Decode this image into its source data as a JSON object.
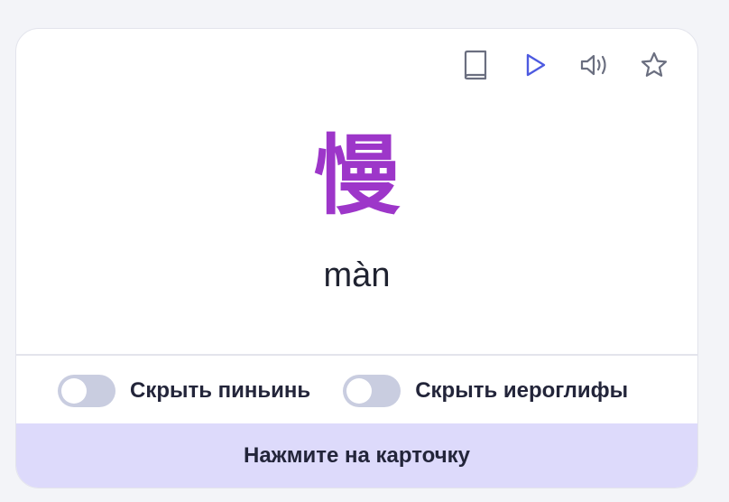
{
  "card": {
    "hanzi": "慢",
    "pinyin": "màn"
  },
  "toolbar": {
    "icons": [
      "book-icon",
      "play-icon",
      "speaker-icon",
      "star-icon"
    ]
  },
  "toggles": {
    "hide_pinyin_label": "Скрыть пиньинь",
    "hide_pinyin_on": false,
    "hide_hanzi_label": "Скрыть иероглифы",
    "hide_hanzi_on": false
  },
  "footer": {
    "label": "Нажмите на карточку"
  },
  "colors": {
    "hanzi": "#9d36c9",
    "play_accent": "#4d5ae0",
    "footer_bg": "#dddafb",
    "switch_off": "#c9cde0"
  }
}
